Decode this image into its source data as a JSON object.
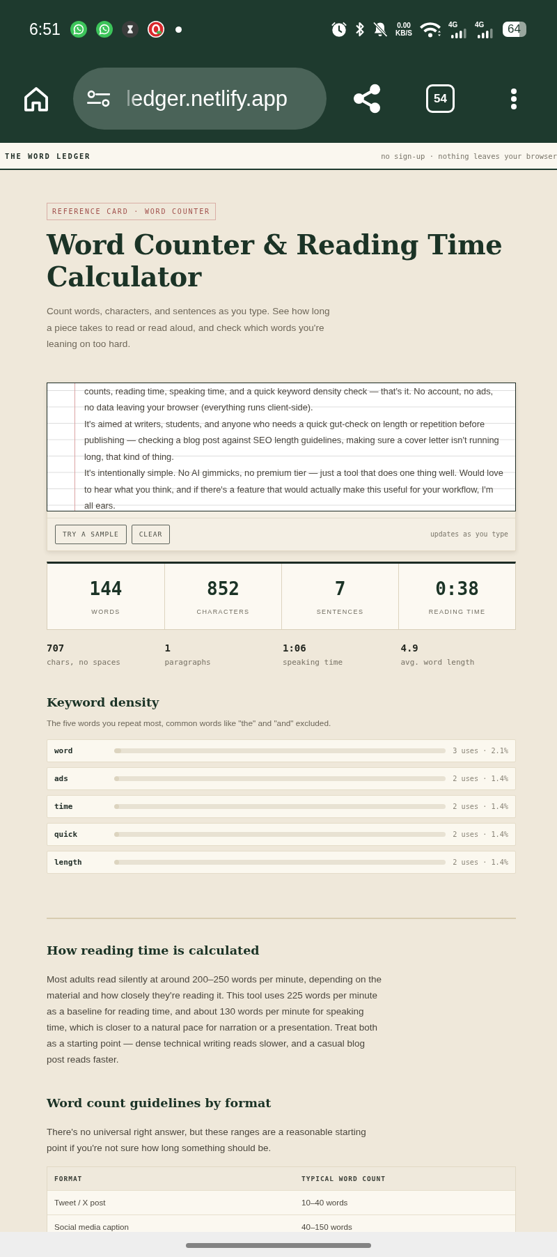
{
  "status_bar": {
    "time": "6:51",
    "network_speed": {
      "value": "0.00",
      "unit": "KB/S"
    },
    "networks": [
      {
        "type": "4G"
      },
      {
        "type": "4G"
      }
    ],
    "battery": "64"
  },
  "browser": {
    "url": "ledger.netlify.app",
    "tab_count": "54"
  },
  "site_header": {
    "brand": "THE WORD LEDGER",
    "tagline": "no sign-up · nothing leaves your browser"
  },
  "hero": {
    "tag": "REFERENCE CARD · WORD COUNTER",
    "title": "Word Counter & Reading Time Calculator",
    "intro": "Count words, characters, and sentences as you type. See how long a piece takes to read or read aloud, and check which words you're leaning on too hard."
  },
  "editor": {
    "value": "counts, reading time, speaking time, and a quick keyword density check — that's it. No account, no ads, no data leaving your browser (everything runs client-side).\nIt's aimed at writers, students, and anyone who needs a quick gut-check on length or repetition before publishing — checking a blog post against SEO length guidelines, making sure a cover letter isn't running long, that kind of thing.\nIt's intentionally simple. No AI gimmicks, no premium tier — just a tool that does one thing well. Would love to hear what you think, and if there's a feature that would actually make this useful for your workflow, I'm all ears.",
    "buttons": [
      {
        "label": "TRY A SAMPLE"
      },
      {
        "label": "CLEAR"
      }
    ],
    "hint": "updates as you type"
  },
  "stats": [
    {
      "value": "144",
      "label": "WORDS"
    },
    {
      "value": "852",
      "label": "CHARACTERS"
    },
    {
      "value": "7",
      "label": "SENTENCES"
    },
    {
      "value": "0:38",
      "label": "READING TIME"
    }
  ],
  "secondary_stats": [
    {
      "value": "707",
      "label": "chars, no spaces"
    },
    {
      "value": "1",
      "label": "paragraphs"
    },
    {
      "value": "1:06",
      "label": "speaking time"
    },
    {
      "value": "4.9",
      "label": "avg. word length"
    }
  ],
  "keyword_density": {
    "title": "Keyword density",
    "description": "The five words you repeat most, common words like \"the\" and \"and\" excluded.",
    "keywords": [
      {
        "word": "word",
        "level": 0.021,
        "reading": "3 uses · 2.1%"
      },
      {
        "word": "ads",
        "level": 0.014,
        "reading": "2 uses · 1.4%"
      },
      {
        "word": "time",
        "level": 0.014,
        "reading": "2 uses · 1.4%"
      },
      {
        "word": "quick",
        "level": 0.014,
        "reading": "2 uses · 1.4%"
      },
      {
        "word": "length",
        "level": 0.014,
        "reading": "2 uses · 1.4%"
      }
    ]
  },
  "reading_time": {
    "title": "How reading time is calculated",
    "body": "Most adults read silently at around 200–250 words per minute, depending on the material and how closely they're reading it. This tool uses 225 words per minute as a baseline for reading time, and about 130 words per minute for speaking time, which is closer to a natural pace for narration or a presentation. Treat both as a starting point — dense technical writing reads slower, and a casual blog post reads faster."
  },
  "guidelines": {
    "title": "Word count guidelines by format",
    "description": "There's no universal right answer, but these ranges are a reasonable starting point if you're not sure how long something should be.",
    "table": {
      "columns": [
        "FORMAT",
        "TYPICAL WORD COUNT"
      ],
      "rows": [
        [
          "Tweet / X post",
          "10–40 words"
        ],
        [
          "Social media caption",
          "40–150 words"
        ]
      ]
    }
  }
}
